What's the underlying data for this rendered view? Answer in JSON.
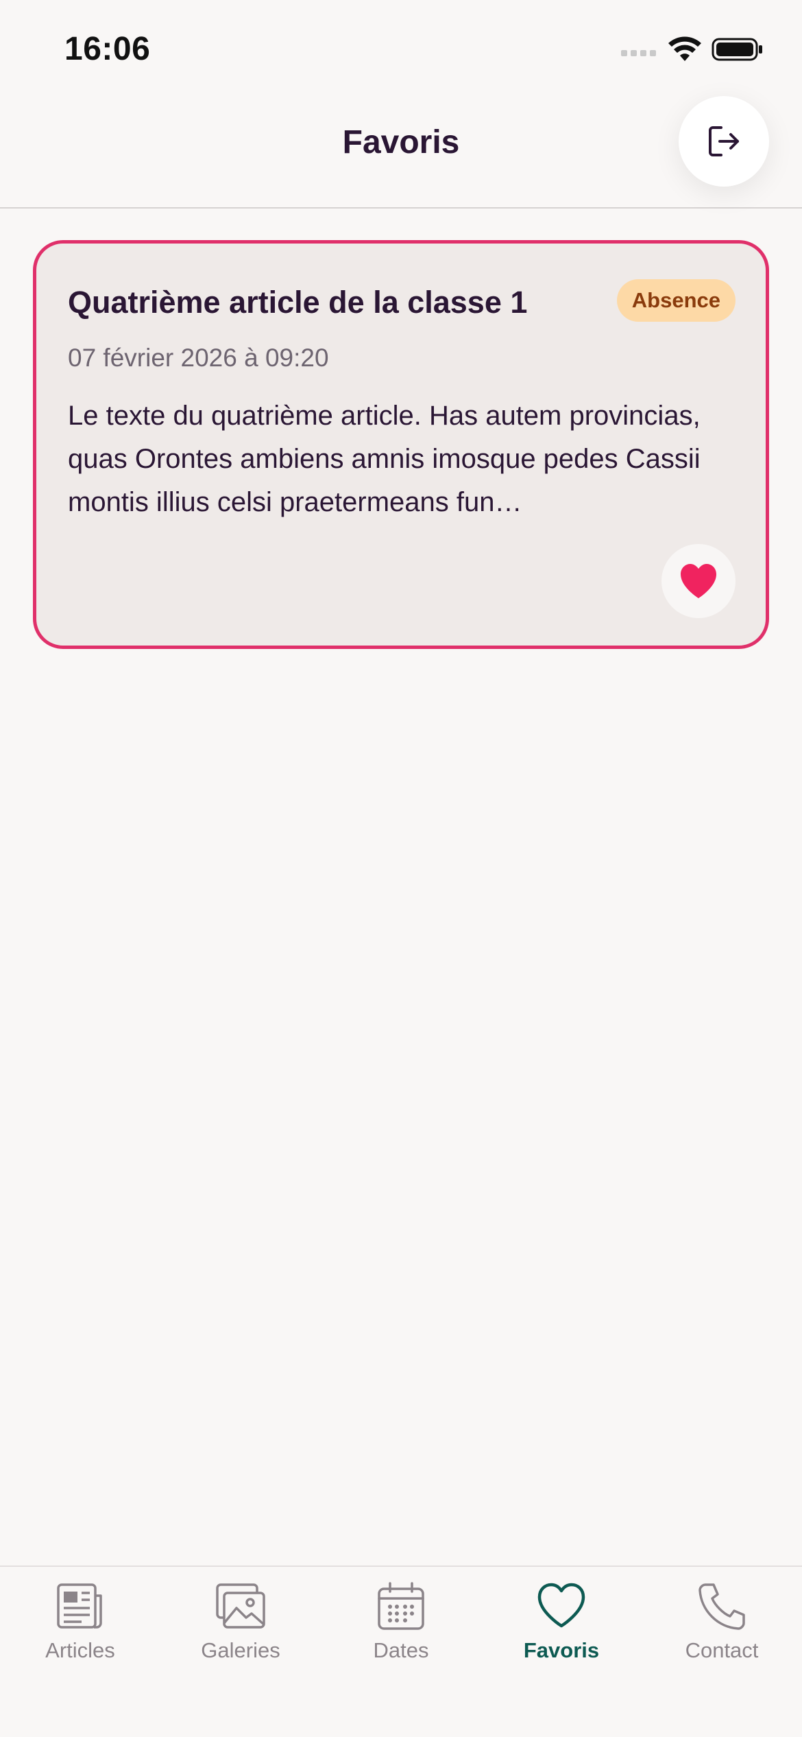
{
  "status_bar": {
    "time": "16:06"
  },
  "header": {
    "title": "Favoris",
    "logout_icon": "logout-icon"
  },
  "article": {
    "title": "Quatrième article de la classe 1",
    "badge": "Absence",
    "date": "07 février 2026 à 09:20",
    "excerpt": "Le texte du quatrième article. Has autem provincias, quas Orontes ambiens amnis imosque pedes Cassii montis illius celsi praetermeans fun…",
    "favorite_icon": "heart-filled-icon"
  },
  "tabs": [
    {
      "label": "Articles",
      "icon": "newspaper-icon"
    },
    {
      "label": "Galeries",
      "icon": "gallery-icon"
    },
    {
      "label": "Dates",
      "icon": "calendar-icon"
    },
    {
      "label": "Favoris",
      "icon": "heart-outline-icon",
      "active": true
    },
    {
      "label": "Contact",
      "icon": "phone-icon"
    }
  ],
  "colors": {
    "accent": "#e0306a",
    "active_tab": "#0d5a52",
    "badge_bg": "#fdd9a6",
    "badge_text": "#8a3b0c",
    "heart": "#f0235f"
  }
}
